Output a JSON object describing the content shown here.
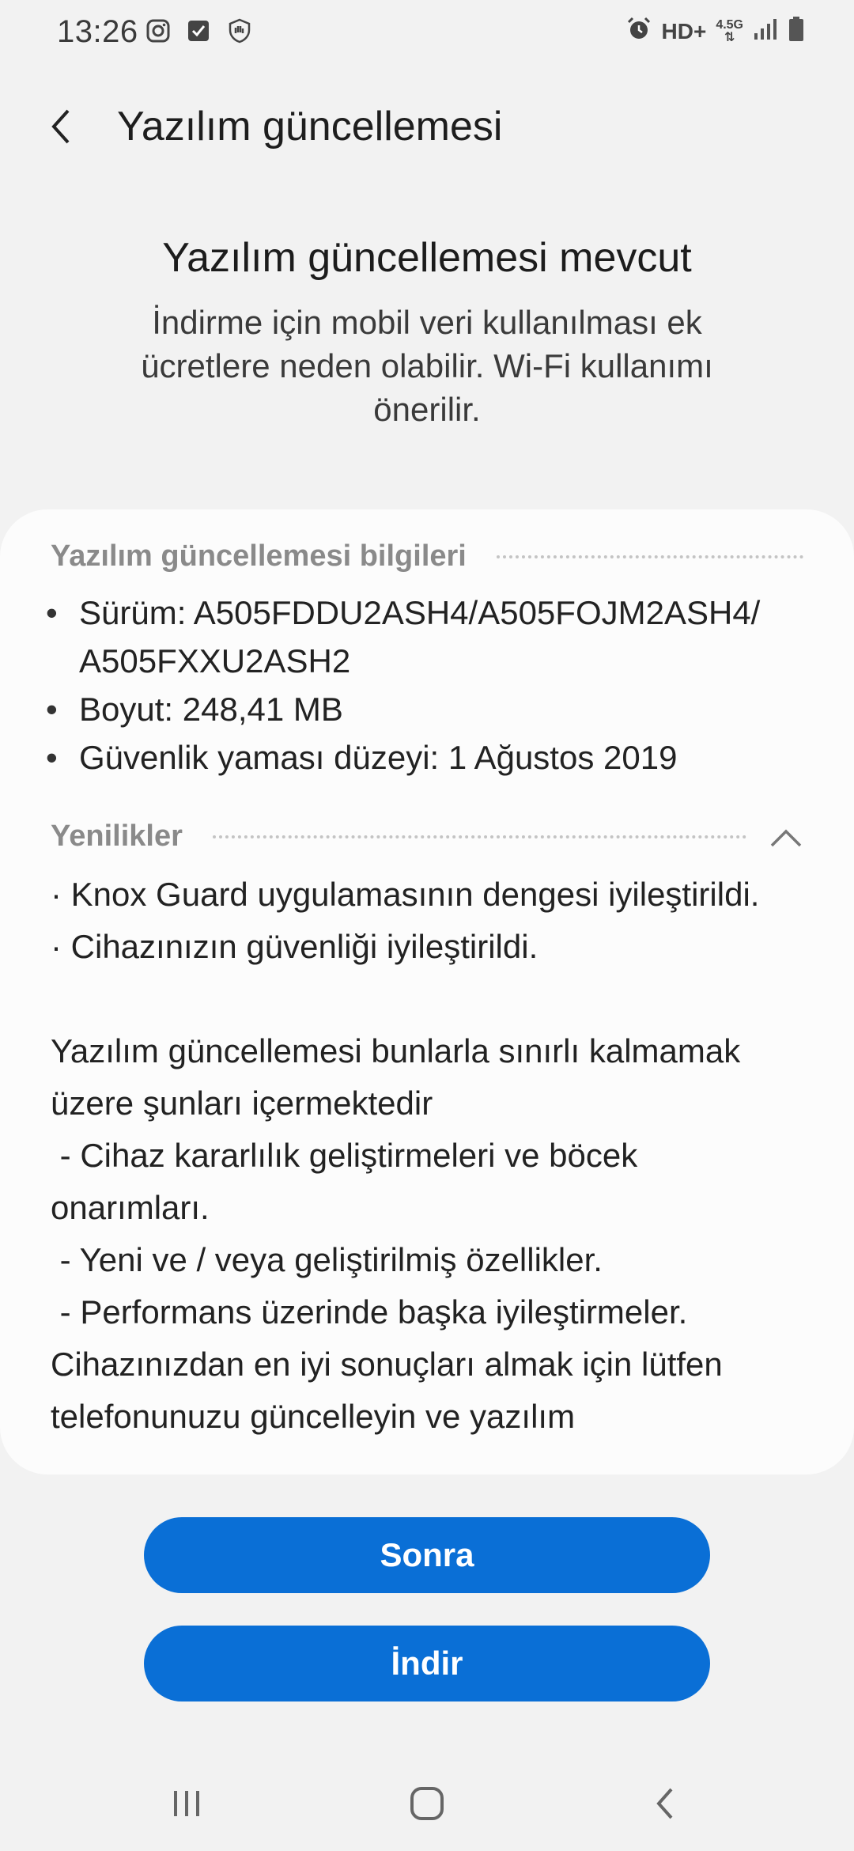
{
  "status_bar": {
    "time": "13:26",
    "left_icons": [
      "instagram-icon",
      "checkbox-icon",
      "shield-hand-icon"
    ],
    "hd_label": "HD+",
    "network_label": "4.5G",
    "right_icons": [
      "alarm-icon",
      "signal-icon",
      "battery-icon"
    ]
  },
  "app_bar": {
    "title": "Yazılım güncellemesi"
  },
  "header": {
    "title": "Yazılım güncellemesi mevcut",
    "description": "İndirme için mobil veri kullanılması ek ücretlere neden olabilir. Wi-Fi kullanımı önerilir."
  },
  "info_section": {
    "label": "Yazılım güncellemesi bilgileri",
    "items": [
      "Sürüm: A505FDDU2ASH4/A505FOJM2ASH4/ A505FXXU2ASH2",
      "Boyut: 248,41 MB",
      "Güvenlik yaması düzeyi: 1 Ağustos 2019"
    ]
  },
  "whats_new": {
    "label": "Yenilikler",
    "paragraphs": [
      "· Knox Guard uygulamasının dengesi iyileştirildi.",
      "· Cihazınızın güvenliği iyileştirildi.",
      "",
      "Yazılım güncellemesi bunlarla sınırlı kalmamak üzere şunları içermektedir",
      " - Cihaz kararlılık geliştirmeleri ve böcek onarımları.",
      " - Yeni ve / veya geliştirilmiş özellikler.",
      " - Performans üzerinde başka iyileştirmeler.",
      "Cihazınızdan en iyi sonuçları almak için lütfen telefonunuzu güncelleyin ve yazılım"
    ]
  },
  "buttons": {
    "later": "Sonra",
    "download": "İndir"
  },
  "colors": {
    "accent": "#0a6fd6",
    "background": "#f2f2f2",
    "card": "#fcfcfc"
  }
}
